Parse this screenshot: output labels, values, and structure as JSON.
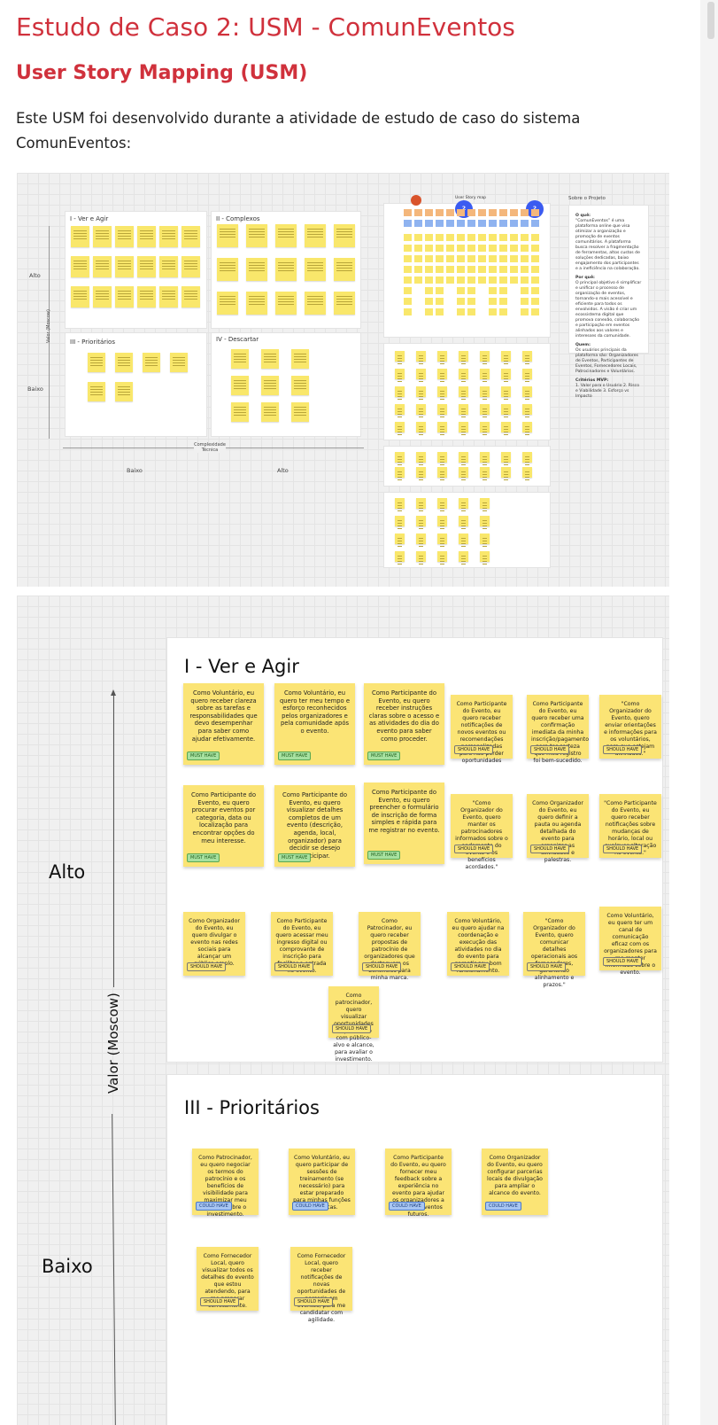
{
  "page": {
    "title": "Estudo de Caso 2: USM - ComunEventos",
    "subtitle": "User Story Mapping (USM)",
    "intro": "Este USM foi desenvolvido durante a atividade de estudo de caso do sistema ComunEventos:"
  },
  "colors": {
    "heading": "#d0313c",
    "note": "#fbe475",
    "must": "#a7e1a0",
    "could": "#a8c6f2",
    "dot": "#3b5bf0"
  },
  "overview": {
    "quadrants": [
      "I - Ver e Agir",
      "II - Complexos",
      "III - Prioritários",
      "IV - Descartar"
    ],
    "y_high": "Alto",
    "y_low": "Baixo",
    "y_axis": "Valor (Moscow)",
    "x_axis": "Complexidade Técnica",
    "x_low": "Baixo",
    "x_high": "Alto",
    "map_title": "User Story map",
    "dot_label": "2",
    "side_title": "Sobre o Projeto",
    "side_sections": [
      {
        "heading": "O quê:",
        "text": "“ComunEventos” é uma plataforma online que visa otimizar a organização e promoção de eventos comunitários. A plataforma busca resolver a fragmentação de ferramentas, altos custos de soluções dedicadas, baixo engajamento dos participantes e a ineficiência na colaboração."
      },
      {
        "heading": "Por quê:",
        "text": "O principal objetivo é simplificar e unificar o processo de organização de eventos, tornando-o mais acessível e eficiente para todos os envolvidos. A visão é criar um ecossistema digital que promova conexão, colaboração e participação em eventos alinhados aos valores e interesses da comunidade."
      },
      {
        "heading": "Quem:",
        "text": "Os usuários principais da plataforma são: Organizadores de Eventos, Participantes de Eventos, Fornecedores Locais, Patrocinadores e Voluntários."
      },
      {
        "heading": "Critérios MVP:",
        "text": "1. Valor para o Usuário 2. Risco e Viabilidade 3. Esforço vs Impacto"
      }
    ]
  },
  "detail": {
    "panel1_title": "I - Ver e Agir",
    "panel3_title": "III - Prioritários",
    "y_high": "Alto",
    "y_low": "Baixo",
    "y_axis": "Valor (Moscow)",
    "notes1": [
      {
        "text": "Como Voluntário, eu quero receber clareza sobre as tarefas e responsabilidades que devo desempenhar para saber como ajudar efetivamente.",
        "tag": "MUST HAVE"
      },
      {
        "text": "Como Voluntário, eu quero ter meu tempo e esforço reconhecidos pelos organizadores e pela comunidade após o evento.",
        "tag": "MUST HAVE"
      },
      {
        "text": "Como Participante do Evento, eu quero receber instruções claras sobre o acesso e as atividades do dia do evento para saber como proceder.",
        "tag": "MUST HAVE"
      },
      {
        "text": "Como Participante do Evento, eu quero receber notificações de novos eventos ou recomendações personalizadas para não perder oportunidades",
        "tag": "SHOULD HAVE"
      },
      {
        "text": "Como Participante do Evento, eu quero receber uma confirmação imediata da minha inscrição/pagamento para ter certeza que meu registro foi bem-sucedido.",
        "tag": "SHOULD HAVE"
      },
      {
        "text": "\"Como Organizador do Evento, quero enviar orientações e informações para os voluntários, para que estejam alinhados.\"",
        "tag": "SHOULD HAVE"
      },
      {
        "text": "Como Participante do Evento, eu quero procurar eventos por categoria, data ou localização para encontrar opções do meu interesse.",
        "tag": "MUST HAVE"
      },
      {
        "text": "Como Participante do Evento, eu quero visualizar detalhes completos de um evento (descrição, agenda, local, organizador) para decidir se desejo participar.",
        "tag": "MUST HAVE"
      },
      {
        "text": "Como Participante do Evento, eu quero preencher o formulário de inscrição de forma simples e rápida para me registrar no evento.",
        "tag": "MUST HAVE"
      },
      {
        "text": "\"Como Organizador do Evento, quero manter os patrocinadores informados sobre o andamento do evento e os benefícios acordados.\"",
        "tag": "SHOULD HAVE"
      },
      {
        "text": "Como Organizador do Evento, eu quero definir a pauta ou agenda detalhada do evento para organizar as atividades e palestras.",
        "tag": "SHOULD HAVE"
      },
      {
        "text": "\"Como Participante do Evento, eu quero receber notificações sobre mudanças de horário, local ou qualquer alteração no evento.\"",
        "tag": "SHOULD HAVE"
      },
      {
        "text": "Como Organizador do Evento, eu quero divulgar o evento nas redes sociais para alcançar um público amplo.",
        "tag": "SHOULD HAVE"
      },
      {
        "text": "Como Participante do Evento, eu quero acessar meu ingresso digital ou comprovante de inscrição para facilitar a entrada no evento.",
        "tag": "SHOULD HAVE"
      },
      {
        "text": "Como Patrocinador, eu quero receber propostas de patrocínio de organizadores que destaquem os benefícios para minha marca.",
        "tag": "SHOULD HAVE"
      },
      {
        "text": "Como Voluntário, eu quero ajudar na coordenação e execução das atividades no dia do evento para garantir seu bom funcionamento.",
        "tag": "SHOULD HAVE"
      },
      {
        "text": "\"Como Organizador do Evento, quero comunicar detalhes operacionais aos fornecedores, garantindo alinhamento e prazos.\"",
        "tag": "SHOULD HAVE"
      },
      {
        "text": "Como Voluntário, eu quero ter um canal de comunicação eficaz com os organizadores para me manter informado sobre o evento.",
        "tag": "SHOULD HAVE"
      },
      {
        "text": "Como patrocinador, quero visualizar oportunidades de patrocínio com público-alvo e alcance, para avaliar o investimento.",
        "tag": "SHOULD HAVE"
      }
    ],
    "notes3": [
      {
        "text": "Como Patrocinador, eu quero negociar os termos do patrocínio e os benefícios de visibilidade para maximizar meu retorno sobre o investimento.",
        "tag": "COULD HAVE"
      },
      {
        "text": "Como Voluntário, eu quero participar de sessões de treinamento (se necessário) para estar preparado para minhas funções específicas.",
        "tag": "COULD HAVE"
      },
      {
        "text": "Como Participante do Evento, eu quero fornecer meu feedback sobre a experiência no evento para ajudar os organizadores a melhorar eventos futuros.",
        "tag": "COULD HAVE"
      },
      {
        "text": "Como Organizador do Evento, eu quero configurar parcerias locais de divulgação para ampliar o alcance do evento.",
        "tag": "COULD HAVE"
      },
      {
        "text": "Como Fornecedor Local, quero visualizar todos os detalhes do evento que estou atendendo, para me preparar corretamente.",
        "tag": "SHOULD HAVE"
      },
      {
        "text": "Como Fornecedor Local, quero receber notificações de novas oportunidades de parceria em eventos, para me candidatar com agilidade.",
        "tag": "SHOULD HAVE"
      }
    ]
  }
}
